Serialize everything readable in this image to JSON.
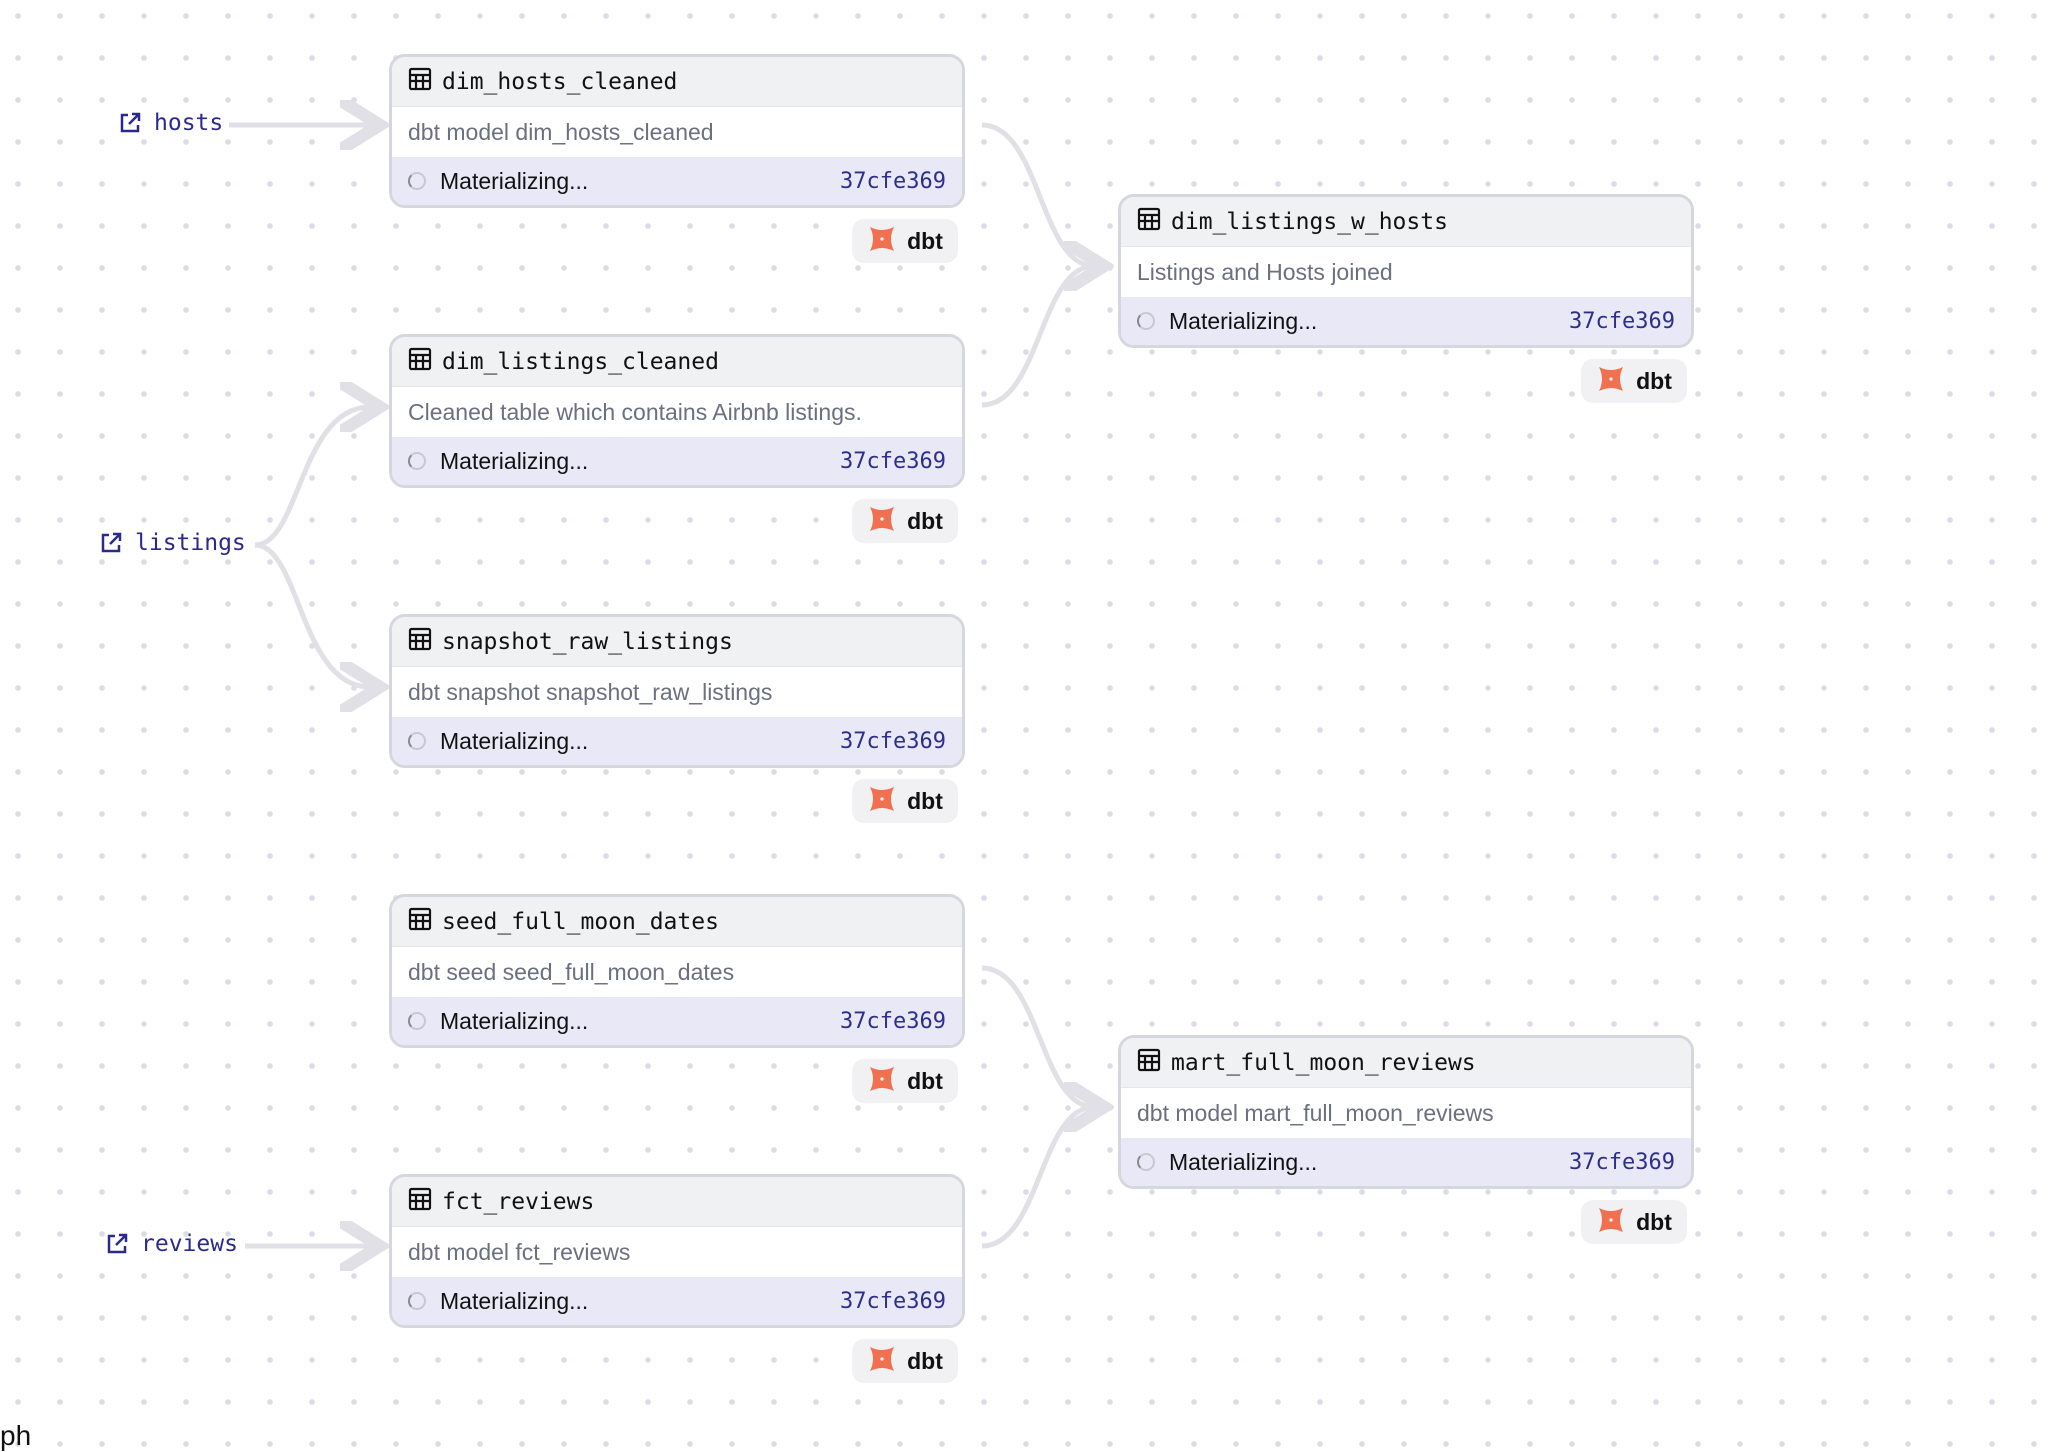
{
  "sources": [
    {
      "name": "hosts",
      "icon": "external-link-icon"
    },
    {
      "name": "listings",
      "icon": "external-link-icon"
    },
    {
      "name": "reviews",
      "icon": "external-link-icon"
    }
  ],
  "nodes": [
    {
      "title": "dim_hosts_cleaned",
      "description": "dbt model dim_hosts_cleaned",
      "status": "Materializing...",
      "hash": "37cfe369",
      "badge": "dbt"
    },
    {
      "title": "dim_listings_cleaned",
      "description": "Cleaned table which contains Airbnb listings.",
      "status": "Materializing...",
      "hash": "37cfe369",
      "badge": "dbt"
    },
    {
      "title": "snapshot_raw_listings",
      "description": "dbt snapshot snapshot_raw_listings",
      "status": "Materializing...",
      "hash": "37cfe369",
      "badge": "dbt"
    },
    {
      "title": "seed_full_moon_dates",
      "description": "dbt seed seed_full_moon_dates",
      "status": "Materializing...",
      "hash": "37cfe369",
      "badge": "dbt"
    },
    {
      "title": "fct_reviews",
      "description": "dbt model fct_reviews",
      "status": "Materializing...",
      "hash": "37cfe369",
      "badge": "dbt"
    },
    {
      "title": "dim_listings_w_hosts",
      "description": "Listings and Hosts joined",
      "status": "Materializing...",
      "hash": "37cfe369",
      "badge": "dbt"
    },
    {
      "title": "mart_full_moon_reviews",
      "description": "dbt model mart_full_moon_reviews",
      "status": "Materializing...",
      "hash": "37cfe369",
      "badge": "dbt"
    }
  ],
  "footer_text": "ph",
  "colors": {
    "accent": "#2a2a8c",
    "dbt": "#f0704f",
    "edge": "#e0e0e6"
  }
}
